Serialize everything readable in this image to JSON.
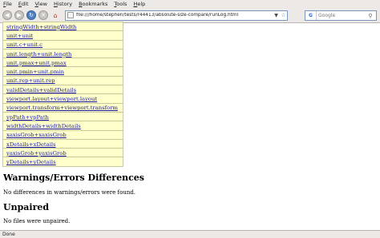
{
  "menu": [
    "File",
    "Edit",
    "View",
    "History",
    "Bookmarks",
    "Tools",
    "Help"
  ],
  "navbar": {
    "url": "file:///home/stephen/tests/r44413/absolute-size-compare/runLog.html",
    "search_placeholder": "Google",
    "search_engine_icon": "G"
  },
  "file_links": [
    "stringWidth+stringWidth",
    "unit+unit",
    "unit.c+unit.c",
    "unit.length+unit.length",
    "unit.pmax+unit.pmax",
    "unit.pmin+unit.pmin",
    "unit.rep+unit.rep",
    "validDetails+validDetails",
    "viewport.layout+viewport.layout",
    "viewport.transform+viewport.transform",
    "vpPath+vpPath",
    "widthDetails+widthDetails",
    "xaxisGrob+xaxisGrob",
    "xDetails+xDetails",
    "yaxisGrob+yaxisGrob",
    "yDetails+yDetails"
  ],
  "sections": {
    "warnings_heading": "Warnings/Errors Differences",
    "warnings_text": "No differences in warnings/errors were found.",
    "unpaired_heading": "Unpaired",
    "unpaired_text": "No files were unpaired."
  },
  "status": "Done"
}
